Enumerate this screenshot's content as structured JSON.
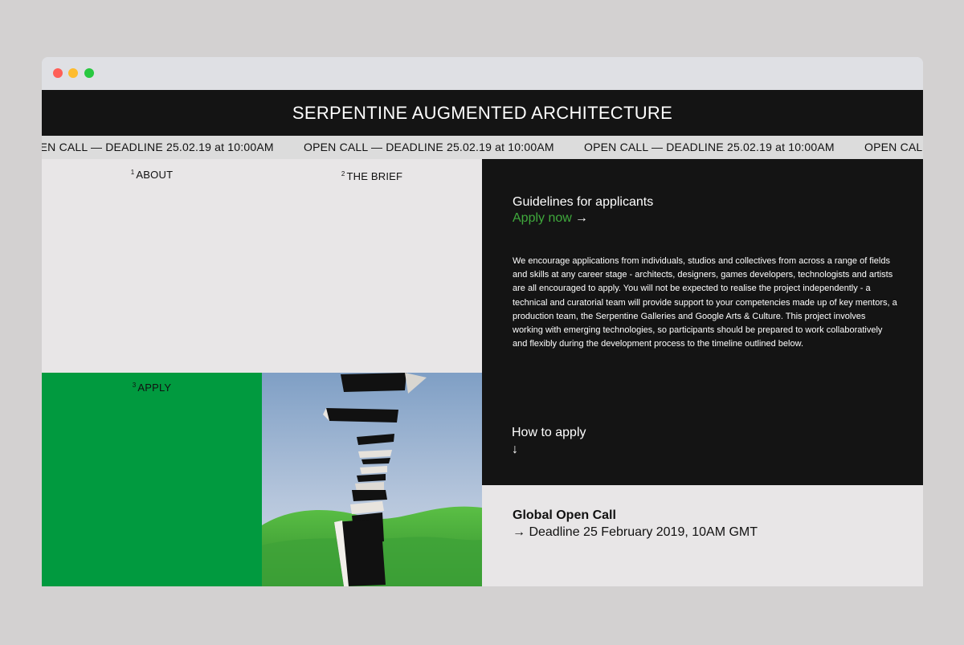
{
  "header": {
    "title": "SERPENTINE AUGMENTED ARCHITECTURE"
  },
  "ticker": {
    "text": "OPEN CALL — DEADLINE 25.02.19 at 10:00AM"
  },
  "nav": [
    {
      "number": "1",
      "label": "ABOUT"
    },
    {
      "number": "2",
      "label": "THE BRIEF"
    },
    {
      "number": "3",
      "label": "APPLY"
    }
  ],
  "guidelines": {
    "title": "Guidelines for applicants",
    "apply_link": "Apply now",
    "apply_arrow": "→",
    "body": "We encourage applications from individuals, studios and collectives from across a range of fields and skills at any career stage - architects, designers, games developers, technologists and artists are all encouraged to apply. You will not be expected to realise the project independently - a technical and curatorial team will provide support to your competencies made up of key mentors, a production team, the Serpentine Galleries and Google Arts & Culture. This project involves working with emerging technologies, so participants should be prepared to work collaboratively and flexibly during the development process to the timeline outlined below.",
    "how_to_apply": "How to apply",
    "down_arrow": "↓"
  },
  "open_call": {
    "title": "Global Open Call",
    "deadline": "→ Deadline 25 February 2019, 10AM GMT"
  },
  "colors": {
    "header_bg": "#141414",
    "apply_panel": "#019a3f",
    "link_green": "#3fa93c",
    "panel_bg": "#e8e6e7"
  }
}
